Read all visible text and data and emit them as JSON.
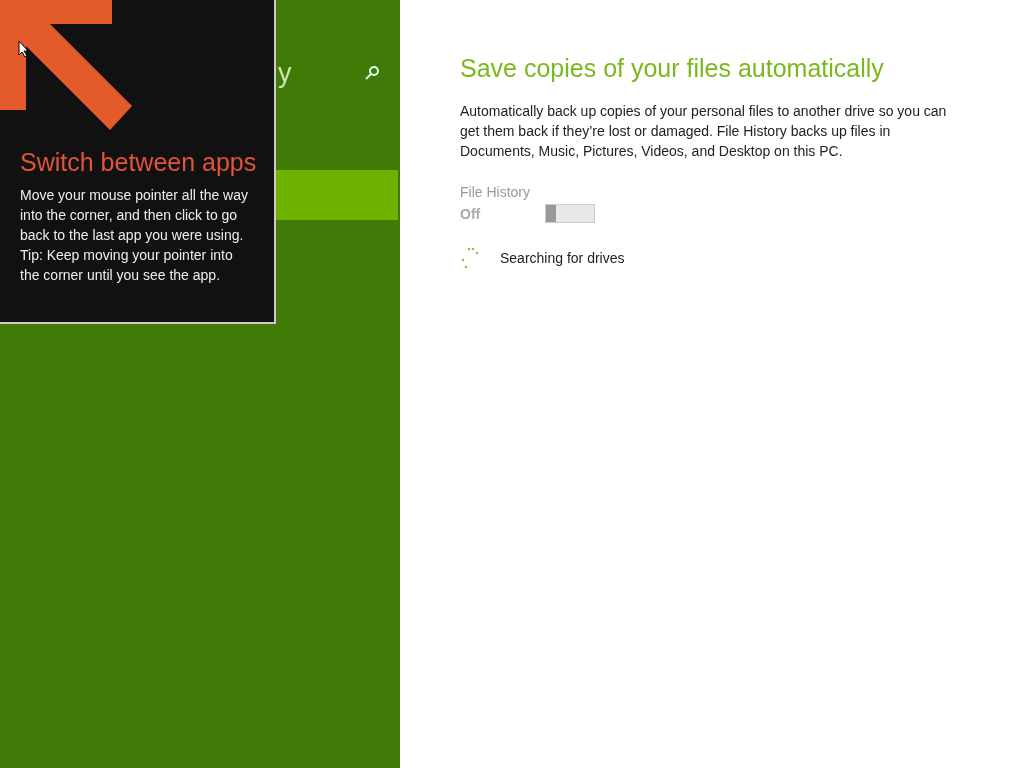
{
  "sidebar": {
    "title": "y",
    "items": [
      {
        "selected": true
      }
    ]
  },
  "tip": {
    "title": "Switch between apps",
    "body": "Move your mouse pointer all the way into the corner, and then click to go back to the last app you were using.",
    "hint": "Tip: Keep moving your pointer into the corner until you see the app."
  },
  "main": {
    "heading": "Save copies of your files automatically",
    "description": "Automatically back up copies of your personal files to another drive so you can get them back if they’re lost or damaged. File History backs up files in Documents, Music, Pictures, Videos, and Desktop on this PC.",
    "toggle": {
      "label": "File History",
      "state": "Off",
      "on": false,
      "disabled": true
    },
    "status": "Searching for drives"
  }
}
